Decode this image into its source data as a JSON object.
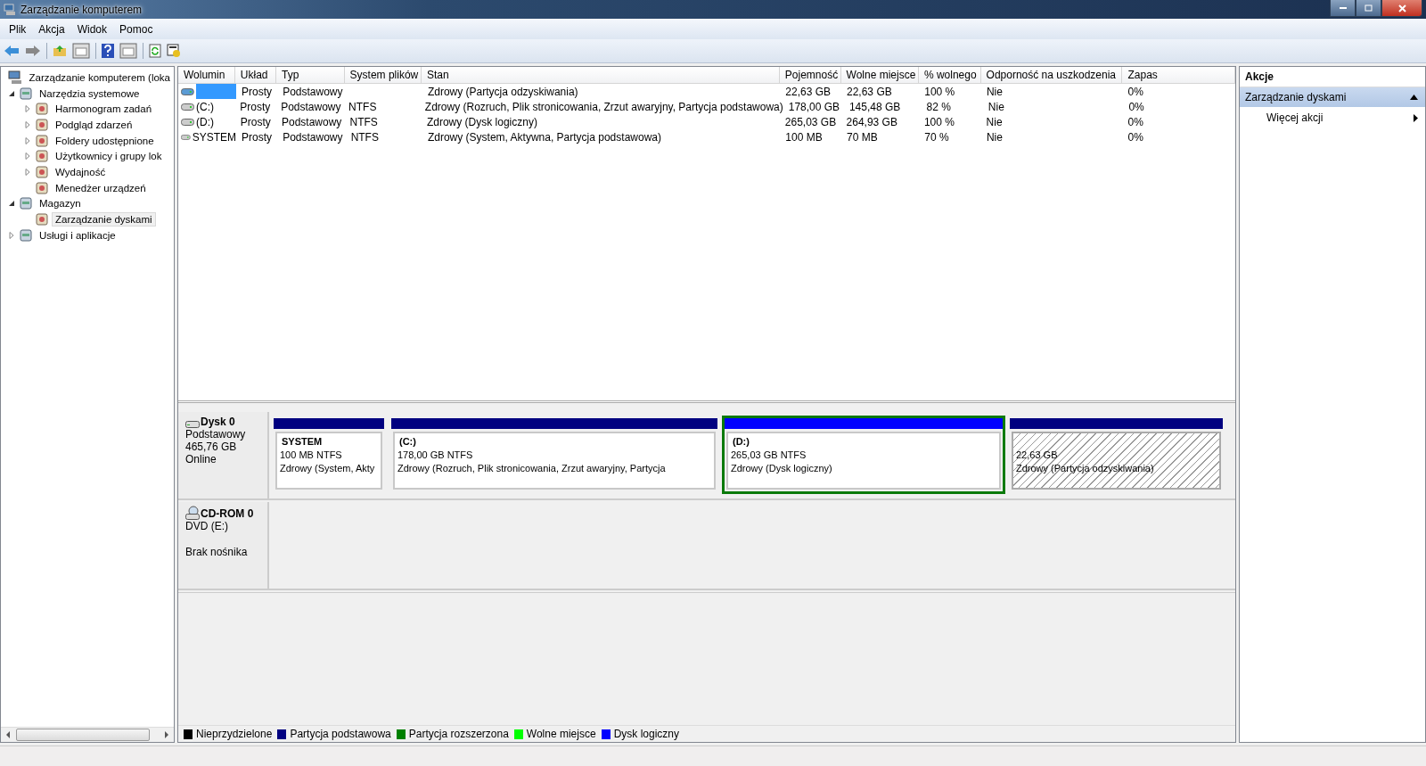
{
  "window": {
    "title": "Zarządzanie komputerem"
  },
  "menu": [
    "Plik",
    "Akcja",
    "Widok",
    "Pomoc"
  ],
  "tree": [
    {
      "label": "Zarządzanie komputerem (loka",
      "selected": false,
      "children": [
        {
          "label": "Narzędzia systemowe",
          "selected": false,
          "expanded": true,
          "children": [
            {
              "label": "Harmonogram zadań",
              "selected": false,
              "expanded": false
            },
            {
              "label": "Podgląd zdarzeń",
              "selected": false,
              "expanded": false
            },
            {
              "label": "Foldery udostępnione",
              "selected": false,
              "expanded": false
            },
            {
              "label": "Użytkownicy i grupy lok",
              "selected": false,
              "expanded": false
            },
            {
              "label": "Wydajność",
              "selected": false,
              "expanded": false
            },
            {
              "label": "Menedżer urządzeń",
              "selected": false
            }
          ]
        },
        {
          "label": "Magazyn",
          "selected": false,
          "expanded": true,
          "children": [
            {
              "label": "Zarządzanie dyskami",
              "selected": true
            }
          ]
        },
        {
          "label": "Usługi i aplikacje",
          "selected": false,
          "expanded": false
        }
      ]
    }
  ],
  "table": {
    "columns": [
      "Wolumin",
      "Układ",
      "Typ",
      "System plików",
      "Stan",
      "Pojemność",
      "Wolne miejsce",
      "% wolnego",
      "Odporność na uszkodzenia",
      "Zapas"
    ],
    "rows": [
      {
        "selected": true,
        "cells": [
          "",
          "Prosty",
          "Podstawowy",
          "",
          "Zdrowy (Partycja odzyskiwania)",
          "22,63 GB",
          "22,63 GB",
          "100 %",
          "Nie",
          "0%"
        ]
      },
      {
        "selected": false,
        "cells": [
          "(C:)",
          "Prosty",
          "Podstawowy",
          "NTFS",
          "Zdrowy (Rozruch, Plik stronicowania, Zrzut awaryjny, Partycja podstawowa)",
          "178,00 GB",
          "145,48 GB",
          "82 %",
          "Nie",
          "0%"
        ]
      },
      {
        "selected": false,
        "cells": [
          "(D:)",
          "Prosty",
          "Podstawowy",
          "NTFS",
          "Zdrowy (Dysk logiczny)",
          "265,03 GB",
          "264,93 GB",
          "100 %",
          "Nie",
          "0%"
        ]
      },
      {
        "selected": false,
        "cells": [
          "SYSTEM",
          "Prosty",
          "Podstawowy",
          "NTFS",
          "Zdrowy (System, Aktywna, Partycja podstawowa)",
          "100 MB",
          "70 MB",
          "70 %",
          "Nie",
          "0%"
        ]
      }
    ]
  },
  "disks": [
    {
      "kind": "disk",
      "name": "Dysk 0",
      "lines": [
        "Podstawowy",
        "465,76 GB",
        "Online"
      ],
      "partitions": [
        {
          "kind": "normal",
          "name": "SYSTEM",
          "size": "100 MB NTFS",
          "status": "Zdrowy (System, Akty",
          "color": "#000080",
          "selected": false
        },
        {
          "kind": "normal",
          "name": "(C:)",
          "size": "178,00 GB NTFS",
          "status": "Zdrowy (Rozruch, Plik stronicowania, Zrzut awaryjny, Partycja",
          "color": "#000080",
          "selected": false
        },
        {
          "kind": "normal",
          "name": "(D:)",
          "size": "265,03 GB NTFS",
          "status": "Zdrowy (Dysk logiczny)",
          "color": "#0000ff",
          "selected": true
        },
        {
          "kind": "hatched",
          "size": "22,63 GB",
          "status": "Zdrowy (Partycja odzyskiwania)",
          "color": "#000080",
          "selected": false
        }
      ]
    },
    {
      "kind": "cdrom",
      "name": "CD-ROM 0",
      "lines": [
        "DVD (E:)",
        "Brak nośnika"
      ]
    }
  ],
  "legend": [
    {
      "label": "Nieprzydzielone",
      "color": "#000000"
    },
    {
      "label": "Partycja podstawowa",
      "color": "#000080"
    },
    {
      "label": "Partycja rozszerzona",
      "color": "#008000"
    },
    {
      "label": "Wolne miejsce",
      "color": "#00ff00"
    },
    {
      "label": "Dysk logiczny",
      "color": "#0000ff"
    }
  ],
  "actions": {
    "title": "Akcje",
    "section": {
      "label": "Zarządzanie dyskami",
      "expanded": true
    },
    "items": [
      "Więcej akcji"
    ]
  }
}
